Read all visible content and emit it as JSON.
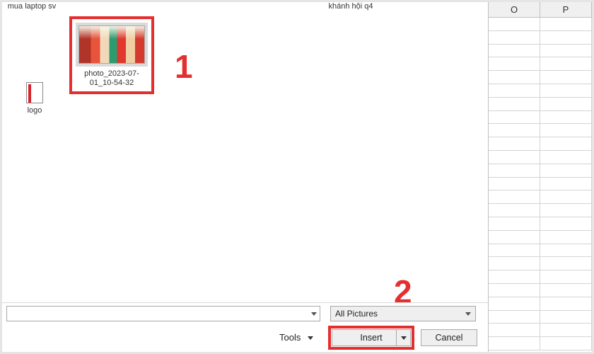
{
  "sheet": {
    "columns": [
      "O",
      "P"
    ]
  },
  "folders": {
    "a": "mua laptop sv",
    "b": "khánh hội q4"
  },
  "files": {
    "logo": {
      "label": "logo"
    },
    "photo": {
      "label": "photo_2023-07-01_10-54-32"
    }
  },
  "annotations": {
    "one": "1",
    "two": "2"
  },
  "dialog": {
    "filetype": "All Pictures",
    "tools_label": "Tools",
    "insert_label": "Insert",
    "cancel_label": "Cancel"
  }
}
